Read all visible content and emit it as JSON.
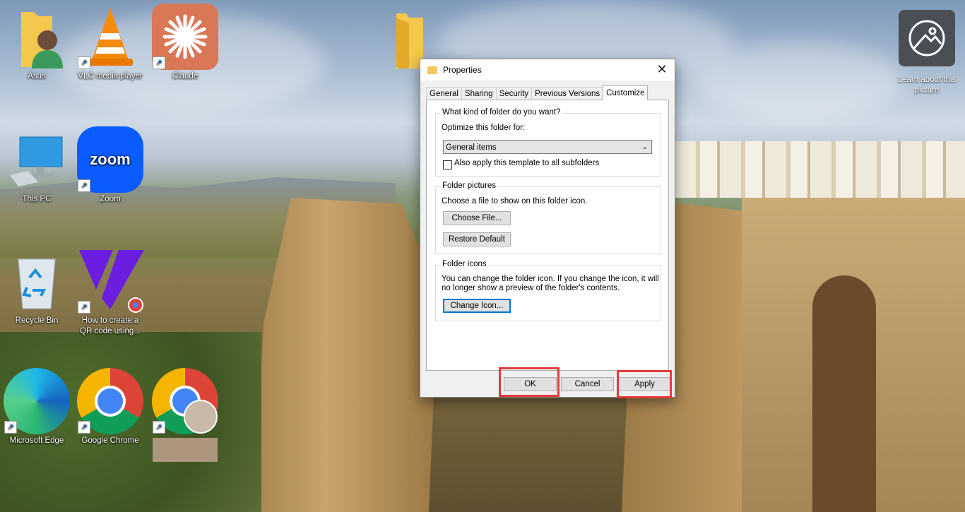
{
  "desktop": {
    "icons": [
      {
        "label": "Asus"
      },
      {
        "label": "VLC media player"
      },
      {
        "label": "Claude"
      },
      {
        "label": "This PC"
      },
      {
        "label": "Zoom",
        "glyph": "zoom"
      },
      {
        "label": "Recycle Bin"
      },
      {
        "label": "How to create a QR code using..."
      },
      {
        "label": "Microsoft Edge"
      },
      {
        "label": "Google Chrome"
      }
    ],
    "learn_label": "Learn about this picture"
  },
  "dialog": {
    "title": "Properties",
    "close_glyph": "✕",
    "tabs": [
      "General",
      "Sharing",
      "Security",
      "Previous Versions",
      "Customize"
    ],
    "active_tab": "Customize",
    "folder_type": {
      "heading": "What kind of folder do you want?",
      "optimize_label": "Optimize this folder for:",
      "selected": "General items",
      "apply_subfolders_label": "Also apply this template to all subfolders",
      "apply_subfolders_checked": false
    },
    "folder_pictures": {
      "heading": "Folder pictures",
      "description": "Choose a file to show on this folder icon.",
      "choose_button": "Choose File...",
      "restore_button": "Restore Default"
    },
    "folder_icons": {
      "heading": "Folder icons",
      "description_line1": "You can change the folder icon. If you change the icon, it will",
      "description_line2": "no longer show a preview of the folder's contents.",
      "change_button": "Change Icon..."
    },
    "footer": {
      "ok": "OK",
      "cancel": "Cancel",
      "apply": "Apply"
    }
  },
  "colors": {
    "highlight": "#e63a3a",
    "focus": "#0078d7"
  }
}
